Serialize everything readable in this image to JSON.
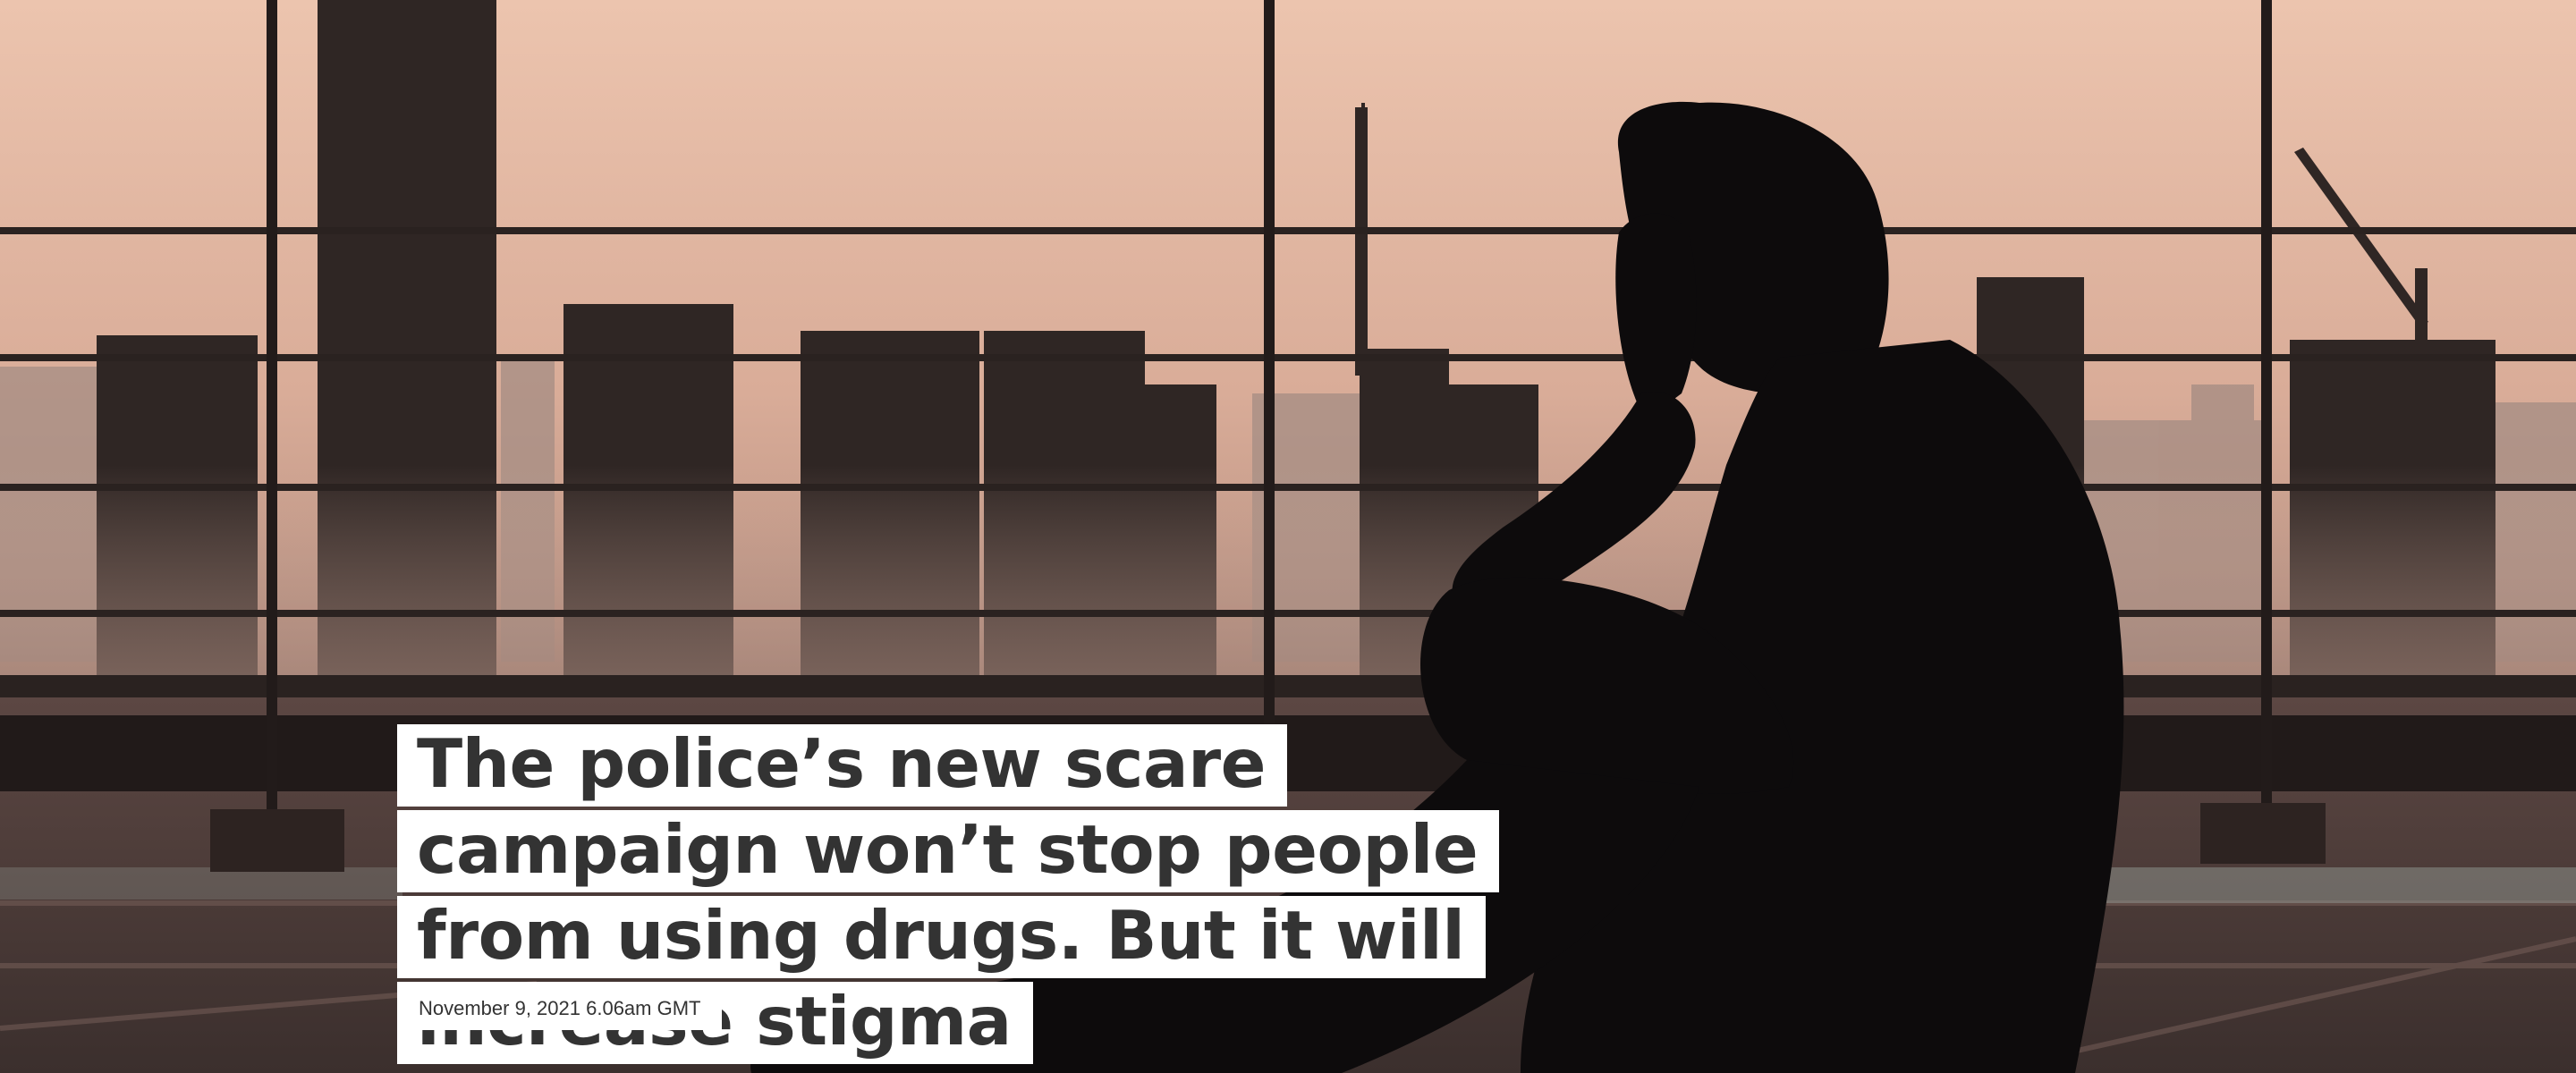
{
  "article": {
    "headline": "The police’s new scare campaign won’t stop people from using drugs. But it will increase stigma",
    "date": "November 9, 2021 6.06am GMT"
  },
  "hero_image": {
    "icon": "silhouette-of-distressed-person-on-rooftop-photo",
    "colors": {
      "sky_top": "#ecc4ae",
      "sky_bottom": "#cfa291",
      "buildings": "#2f2624",
      "silhouette": "#0d0b0c",
      "floor": "#4a3a37",
      "railing": "#2a2220"
    }
  },
  "colors": {
    "headline_text": "#333333",
    "label_background": "#ffffff"
  }
}
